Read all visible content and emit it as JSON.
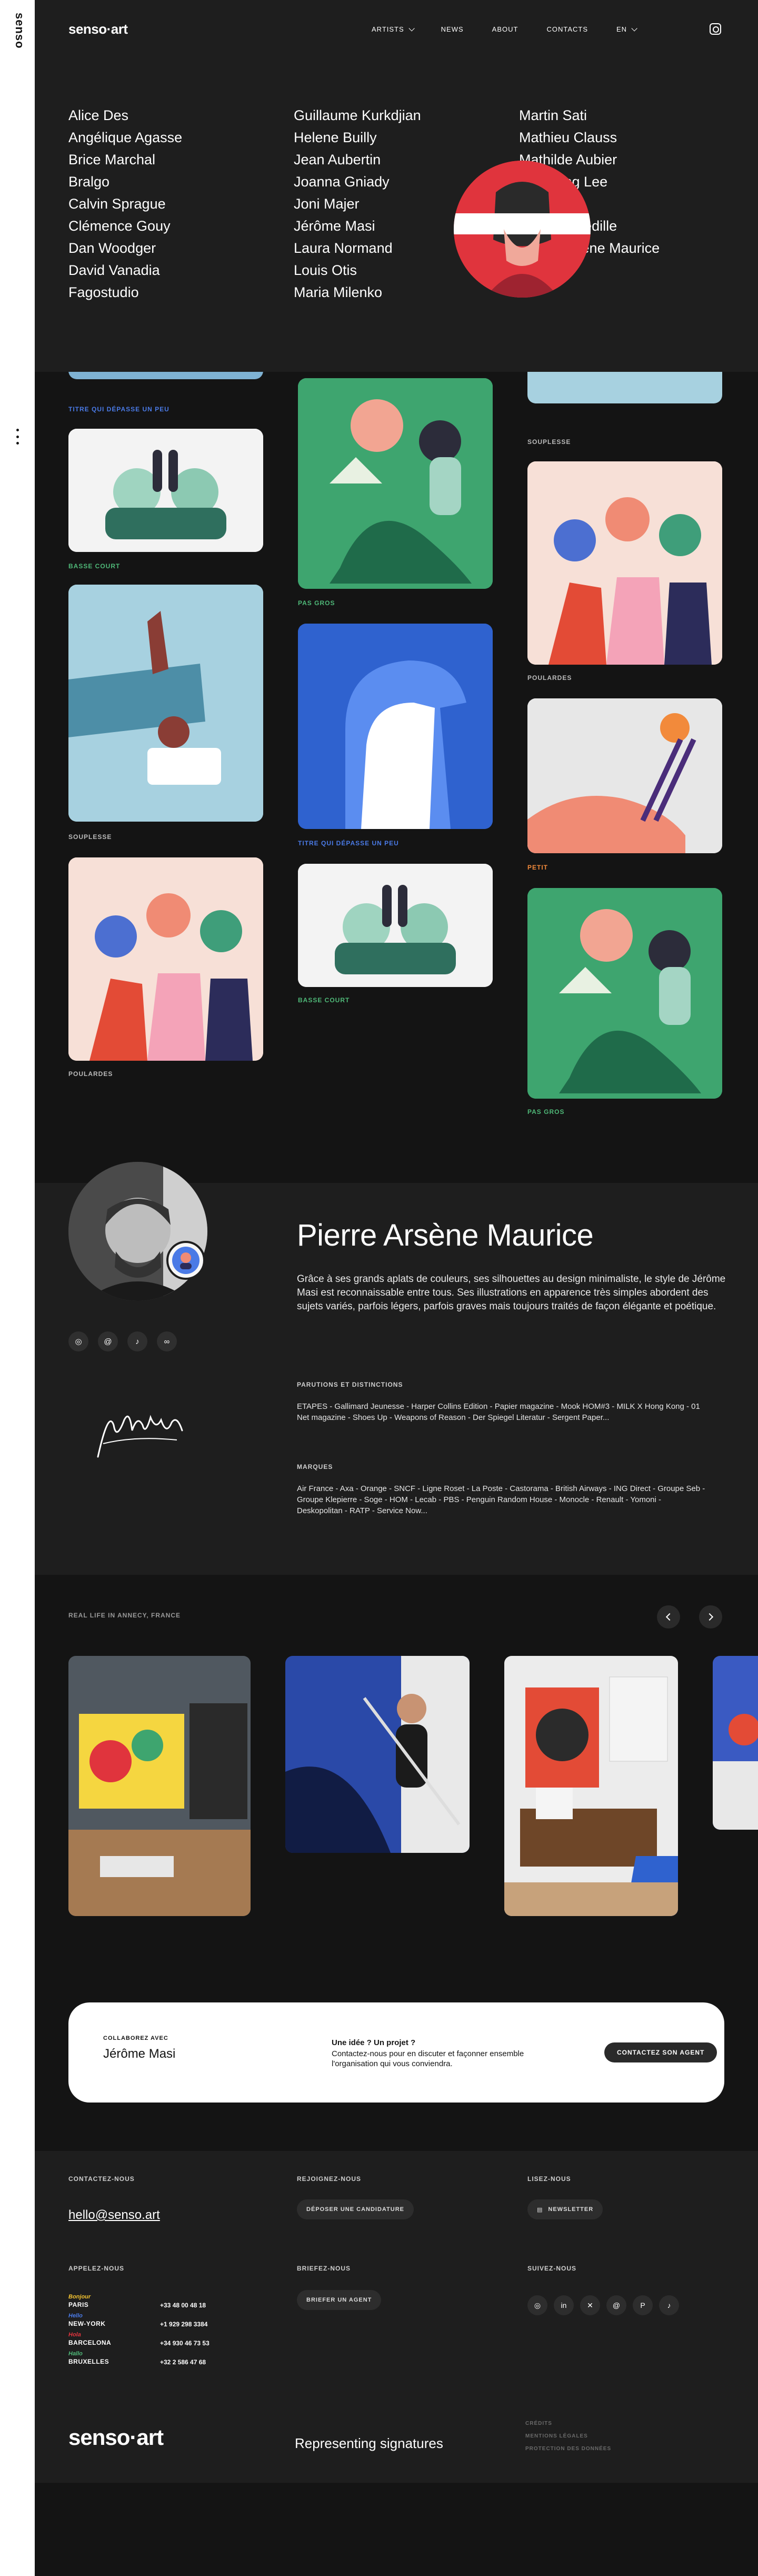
{
  "rail": {
    "logo": "senso"
  },
  "header": {
    "brand": "senso·art",
    "nav": [
      {
        "label": "Artists",
        "has_dropdown": true
      },
      {
        "label": "News"
      },
      {
        "label": "About"
      },
      {
        "label": "Contacts"
      },
      {
        "label": "EN",
        "has_dropdown": true
      }
    ],
    "instagram_icon": "instagram-icon"
  },
  "artists_menu": {
    "col1": [
      "Alice Des",
      "Angélique Agasse",
      "Brice Marchal",
      "Bralgo",
      "Calvin Sprague",
      "Clémence Gouy",
      "Dan Woodger",
      "David Vanadia",
      "Fagostudio"
    ],
    "col2": [
      "Guillaume Kurkdjian",
      "Helene Builly",
      "Jean Aubertin",
      "Joanna Gniady",
      "Joni Majer",
      "Jérôme Masi",
      "Laura Normand",
      "Louis Otis",
      "Maria Milenko"
    ],
    "col3": [
      "Martin Sati",
      "Mathieu Clauss",
      "Mathilde Aubier",
      "Minkyung Lee",
      "Sstudio",
      "Pascale Cédille",
      "Pierre Arsène Maurice",
      "Saturn"
    ]
  },
  "gallery": {
    "captions": {
      "c1_top": "Titre qui dépasse un peu",
      "c1_basse": "Basse court",
      "c1_souplesse": "Souplesse",
      "c1_poulardes": "Poulardes",
      "c2_pasgros": "Pas gros",
      "c2_titre": "Titre qui dépasse un peu",
      "c2_basse": "Basse court",
      "c3_souplesse": "Souplesse",
      "c3_poulardes": "Poulardes",
      "c3_petit": "Petit",
      "c3_pasgros": "Pas gros"
    }
  },
  "profile": {
    "name": "Pierre Arsène Maurice",
    "bio": "Grâce à ses grands aplats de couleurs, ses silhouettes au design minimaliste, le style de Jérôme Masi est reconnaissable entre tous. Ses illustrations en apparence très simples abordent des sujets variés, parfois légers, parfois graves mais toujours traités de façon élégante et poétique.",
    "parutions_title": "Parutions et distinctions",
    "parutions": "ETAPES - Gallimard Jeunesse - Harper Collins Edition - Papier magazine - Mook HOM#3 - MILK X Hong Kong - 01 Net magazine - Shoes Up - Weapons of Reason - Der Spiegel Literatur - Sergent Paper...",
    "marques_title": "Marques",
    "marques": "Air France - Axa - Orange - SNCF - Ligne Roset - La Poste - Castorama - British Airways - ING Direct - Groupe Seb - Groupe Klepierre - Soge - HOM - Lecab - PBS - Penguin Random House - Monocle - Renault - Yomoni - Deskopolitan - RATP - Service Now...",
    "socials": [
      "instagram-icon",
      "threads-icon",
      "tiktok-icon",
      "link-icon"
    ]
  },
  "reallife": {
    "label": "Real life in Annecy, France"
  },
  "collab": {
    "kicker": "Collaborez avec",
    "name": "Jérôme Masi",
    "idea": "Une idée ? Un projet ?",
    "idea_sub": "Contactez-nous pour en discuter et façonner ensemble l'organisation qui vous conviendra.",
    "button": "Contactez son agent"
  },
  "footer": {
    "contact_title": "Contactez-nous",
    "email": "hello@senso.art",
    "call_title": "Appelez-nous",
    "offices": [
      {
        "tag": "Bonjour",
        "tag_color": "#f2c230",
        "city": "Paris",
        "phone": "+33 48 00 48 18"
      },
      {
        "tag": "Hello",
        "tag_color": "#4a7ae6",
        "city": "New-York",
        "phone": "+1 929 298 3384"
      },
      {
        "tag": "Hola",
        "tag_color": "#e0343d",
        "city": "Barcelona",
        "phone": "+34 930 46 73 53"
      },
      {
        "tag": "Hallo",
        "tag_color": "#4fb878",
        "city": "Bruxelles",
        "phone": "+32 2 586 47 68"
      }
    ],
    "join_title": "Rejoignez-nous",
    "join_button": "Déposer une candidature",
    "brief_title": "Briefez-nous",
    "brief_button": "Briefer un agent",
    "read_title": "Lisez-nous",
    "newsletter_button": "Newsletter",
    "follow_title": "Suivez-nous",
    "brand": "senso·art",
    "tagline": "Representing signatures",
    "legal": [
      "Crédits",
      "Mentions légales",
      "Protection des données"
    ]
  }
}
